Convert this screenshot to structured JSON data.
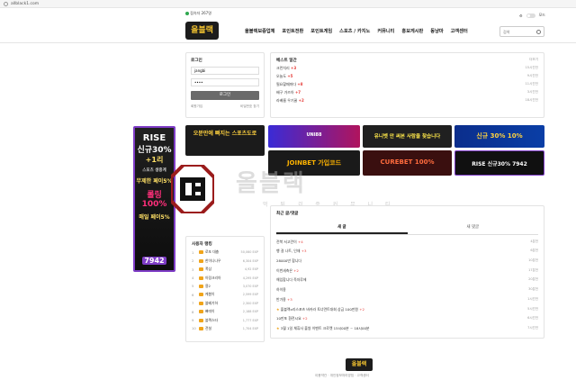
{
  "browser": {
    "url": "allblack1.com"
  },
  "topbar": {
    "online": "접속자 267명",
    "mode": "모드"
  },
  "brand": {
    "logo": "올블랙"
  },
  "nav": [
    "올블랙보증업체",
    "포인트전환",
    "포인트게임",
    "스포츠 / 카지노",
    "커뮤니티",
    "홍보게시판",
    "동냥마",
    "고객센터"
  ],
  "search": {
    "placeholder": "검색"
  },
  "login": {
    "title": "로그인",
    "user_value": "jangbi",
    "pw_value": "••••",
    "button": "로그인",
    "signup": "회원가입",
    "find": "비밀번호 찾기"
  },
  "best": {
    "title": "베스트 일간",
    "more": "더보기",
    "rows": [
      {
        "title": "크런치리",
        "count": "+3",
        "date": "15시간전"
      },
      {
        "title": "오늘도",
        "count": "+5",
        "date": "9시간전"
      },
      {
        "title": "필요할때마다",
        "count": "+8",
        "date": "11시간전"
      },
      {
        "title": "배구 가즈아",
        "count": "+7",
        "date": "3시간전"
      },
      {
        "title": "라베름 우기꿀",
        "count": "+2",
        "date": "18시간전"
      }
    ]
  },
  "banners": {
    "left_rise": {
      "brand": "RISE",
      "line1": "신규30%",
      "line2": "+1리",
      "line3": "스포츠 생중계",
      "line4": "무제한 페이5%",
      "line5": "롤링 100%",
      "line6": "매일 페이5%",
      "code": "7942"
    },
    "b1": "오분만에 빠지는 스포츠도로",
    "b2": "UNI88",
    "b3": "유니벳 안 써본 사람을 찾습니다",
    "b4": "신규 30% 10%",
    "b5": "JOINBET 가입코드",
    "b6": "CUREBET 100%",
    "b7": "RISE 신규30% 7942"
  },
  "watermark": {
    "text": "올블랙",
    "sub": "먹 튀 검 증 커 뮤 니 티"
  },
  "rank": {
    "title": "사용자 랭킹",
    "rows": [
      {
        "no": "1",
        "name": "로또 대충",
        "xp": "50,060 EXP"
      },
      {
        "no": "2",
        "name": "한이나나우",
        "xp": "6,304 EXP"
      },
      {
        "no": "3",
        "name": "폭삼",
        "xp": "4,92 EXP"
      },
      {
        "no": "4",
        "name": "아링크리아",
        "xp": "4,295 EXP"
      },
      {
        "no": "5",
        "name": "용2",
        "xp": "3,070 EXP"
      },
      {
        "no": "6",
        "name": "케봄이",
        "xp": "2,599 EXP"
      },
      {
        "no": "7",
        "name": "블베기하",
        "xp": "2,300 EXP"
      },
      {
        "no": "8",
        "name": "빠띠이",
        "xp": "2,188 EXP"
      },
      {
        "no": "9",
        "name": "블랙스타",
        "xp": "1,777 EXP"
      },
      {
        "no": "10",
        "name": "전설",
        "xp": "1,704 EXP"
      }
    ]
  },
  "recent": {
    "title": "최근 글/댓글",
    "tab_posts": "새 글",
    "tab_comments": "새 댓글",
    "rows": [
      {
        "title": "전북 서고란이",
        "count": "+4",
        "date": "4분전"
      },
      {
        "title": "행 걸 나트, 인재",
        "count": "+3",
        "date": "6분전"
      },
      {
        "title": "28000만 합니다",
        "count": "",
        "date": "10분전"
      },
      {
        "title": "이번새축은",
        "count": "+2",
        "date": "17분전"
      },
      {
        "title": "해입합니다 즉자루에",
        "count": "",
        "date": "20분전"
      },
      {
        "title": "하이용",
        "count": "",
        "date": "30분전"
      },
      {
        "title": "반가용",
        "count": "+3",
        "date": "1시간전"
      },
      {
        "title": "올블랙x리스포츠 바카라 토너먼트대회 상금 100만원",
        "count": "+2",
        "date": "5시간전"
      },
      {
        "title": "10만포 환전시요",
        "count": "+2",
        "date": "6시간전"
      },
      {
        "title": "3월 1일 체휴사 출쌍 이벤트 크로켓 15시00분 ~ 18시00분",
        "count": "",
        "date": "7시간전"
      }
    ]
  },
  "footer": {
    "logo": "올블랙",
    "links": "이용약관 · 개인정보처리방침 · 고객센터"
  }
}
